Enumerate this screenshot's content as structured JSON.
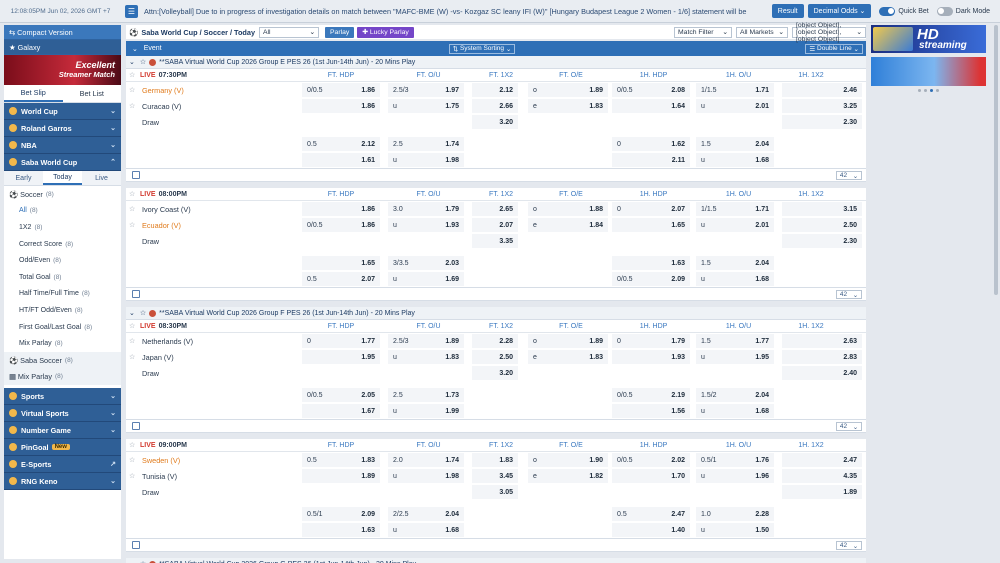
{
  "topbar": {
    "time": "12:08:05PM Jun 02, 2026 GMT +7",
    "marquee": "Attn:[Volleyball] Due to in progress of investigation details on match between \"MAFC-BME (W) -vs- Kozgaz SC leany IFI (W)\" [Hungary Budapest League 2 Women - 1/6] statement will be",
    "result": "Result",
    "odds_type": "Decimal Odds",
    "quick_bet": "Quick Bet",
    "dark_mode": "Dark Mode"
  },
  "sidebar": {
    "compact": "Compact Version",
    "galaxy": "Galaxy",
    "promo1": "Excellent",
    "promo2": "Streamer Match",
    "betslip": "Bet Slip",
    "betlist": "Bet List",
    "cats_top": [
      {
        "label": "World Cup"
      },
      {
        "label": "Roland Garros"
      },
      {
        "label": "NBA"
      },
      {
        "label": "Saba World Cup"
      }
    ],
    "periods": [
      "Early",
      "Today",
      "Live"
    ],
    "soccer": {
      "label": "Soccer",
      "count": "(8)"
    },
    "items": [
      {
        "label": "All",
        "count": "(8)"
      },
      {
        "label": "1X2",
        "count": "(8)"
      },
      {
        "label": "Correct Score",
        "count": "(8)"
      },
      {
        "label": "Odd/Even",
        "count": "(8)"
      },
      {
        "label": "Total Goal",
        "count": "(8)"
      },
      {
        "label": "Half Time/Full Time",
        "count": "(8)"
      },
      {
        "label": "HT/FT Odd/Even",
        "count": "(8)"
      },
      {
        "label": "First Goal/Last Goal",
        "count": "(8)"
      },
      {
        "label": "Mix Parlay",
        "count": "(8)"
      }
    ],
    "saba_soccer": {
      "label": "Saba Soccer",
      "count": "(8)"
    },
    "mix_parlay": {
      "label": "Mix Parlay",
      "count": "(8)"
    },
    "cats_bottom": [
      {
        "label": "Sports"
      },
      {
        "label": "Virtual Sports"
      },
      {
        "label": "Number Game"
      },
      {
        "label": "PinGoal",
        "badge": "New"
      },
      {
        "label": "E-Sports"
      },
      {
        "label": "RNG Keno"
      }
    ]
  },
  "main": {
    "title": "Saba World Cup / Soccer / Today",
    "all": "All",
    "parlay": "Parlay",
    "lucky": "Lucky Parlay",
    "match_filter": "Match Filter",
    "all_markets": "All Markets",
    "leagues": [
      {
        "name": "**SABA Virtual World Cup 2026 Group E PES 26 (1st Jun-14th Jun) - 20 Mins Play"
      },
      {
        "name": "**SABA Virtual World Cup 2026 Group F PES 26 (1st Jun-14th Jun) - 20 Mins Play"
      },
      {
        "name": "**SABA Virtual World Cup 2026 Group G PES 26 (1st Jun-14th Jun) - 20 Mins Play"
      }
    ],
    "event": "Event",
    "system_sorting": "System Sorting",
    "double_line": "Double Line",
    "page": "42",
    "cols": [
      "FT. HDP",
      "FT. O/U",
      "FT. 1X2",
      "FT. O/E",
      "1H. HDP",
      "1H. O/U",
      "1H. 1X2"
    ],
    "matches": [
      {
        "time": "07:30PM",
        "home": "Germany (V)",
        "away": "Curacao (V)",
        "draw": "Draw",
        "r1": [
          "0/0.5",
          "1.86",
          "2.5/3",
          "1.97",
          "2.12",
          "o",
          "1.89",
          "0/0.5",
          "2.08",
          "1/1.5",
          "1.71",
          "2.46"
        ],
        "r2": [
          "",
          "1.86",
          "u",
          "1.75",
          "2.66",
          "e",
          "1.83",
          "",
          "1.64",
          "u",
          "2.01",
          "3.25"
        ],
        "r3": [
          "",
          "",
          "",
          "",
          "3.20",
          "",
          "",
          "",
          "",
          "",
          "",
          "2.30"
        ],
        "a1": [
          "0.5",
          "2.12",
          "2.5",
          "1.74",
          "0",
          "1.62",
          "1.5",
          "2.04"
        ],
        "a2": [
          "",
          "1.61",
          "u",
          "1.98",
          "",
          "2.11",
          "u",
          "1.68"
        ]
      },
      {
        "time": "08:00PM",
        "home": "Ivory Coast (V)",
        "away": "Ecuador (V)",
        "draw": "Draw",
        "r1": [
          "",
          "1.86",
          "3.0",
          "1.79",
          "2.65",
          "o",
          "1.88",
          "0",
          "2.07",
          "1/1.5",
          "1.71",
          "3.15"
        ],
        "r2": [
          "0/0.5",
          "1.86",
          "u",
          "1.93",
          "2.07",
          "e",
          "1.84",
          "",
          "1.65",
          "u",
          "2.01",
          "2.50"
        ],
        "r3": [
          "",
          "",
          "",
          "",
          "3.35",
          "",
          "",
          "",
          "",
          "",
          "",
          "2.30"
        ],
        "a1": [
          "",
          "1.65",
          "3/3.5",
          "2.03",
          "",
          "1.63",
          "1.5",
          "2.04"
        ],
        "a2": [
          "0.5",
          "2.07",
          "u",
          "1.69",
          "0/0.5",
          "2.09",
          "u",
          "1.68"
        ]
      },
      {
        "time": "08:30PM",
        "home": "Netherlands (V)",
        "away": "Japan (V)",
        "draw": "Draw",
        "r1": [
          "0",
          "1.77",
          "2.5/3",
          "1.89",
          "2.28",
          "o",
          "1.89",
          "0",
          "1.79",
          "1.5",
          "1.77",
          "2.63"
        ],
        "r2": [
          "",
          "1.95",
          "u",
          "1.83",
          "2.50",
          "e",
          "1.83",
          "",
          "1.93",
          "u",
          "1.95",
          "2.83"
        ],
        "r3": [
          "",
          "",
          "",
          "",
          "3.20",
          "",
          "",
          "",
          "",
          "",
          "",
          "2.40"
        ],
        "a1": [
          "0/0.5",
          "2.05",
          "2.5",
          "1.73",
          "0/0.5",
          "2.19",
          "1.5/2",
          "2.04"
        ],
        "a2": [
          "",
          "1.67",
          "u",
          "1.99",
          "",
          "1.56",
          "u",
          "1.68"
        ]
      },
      {
        "time": "09:00PM",
        "home": "Sweden (V)",
        "away": "Tunisia (V)",
        "draw": "Draw",
        "r1": [
          "0.5",
          "1.83",
          "2.0",
          "1.74",
          "1.83",
          "o",
          "1.90",
          "0/0.5",
          "2.02",
          "0.5/1",
          "1.76",
          "2.47"
        ],
        "r2": [
          "",
          "1.89",
          "u",
          "1.98",
          "3.45",
          "e",
          "1.82",
          "",
          "1.70",
          "u",
          "1.96",
          "4.35"
        ],
        "r3": [
          "",
          "",
          "",
          "",
          "3.05",
          "",
          "",
          "",
          "",
          "",
          "",
          "1.89"
        ],
        "a1": [
          "0.5/1",
          "2.09",
          "2/2.5",
          "2.04",
          "0.5",
          "2.47",
          "1.0",
          "2.28"
        ],
        "a2": [
          "",
          "1.63",
          "u",
          "1.68",
          "",
          "1.40",
          "u",
          "1.50"
        ]
      }
    ]
  },
  "right": {
    "hd": "HD",
    "streaming": "streaming"
  },
  "live_label": "LIVE"
}
